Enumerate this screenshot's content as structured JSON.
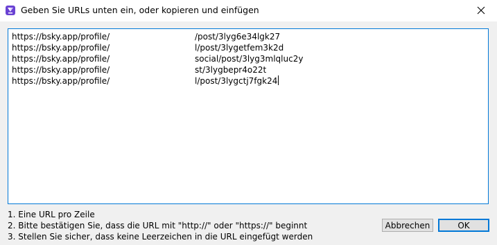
{
  "window": {
    "title": "Geben Sie URLs unten ein, oder kopieren und einfügen",
    "app_icon": "app-icon",
    "close_icon": "close-icon"
  },
  "input": {
    "lines": [
      {
        "prefix": "https://bsky.app/profile/",
        "suffix": "/post/3lyg6e34lgk27"
      },
      {
        "prefix": "https://bsky.app/profile/",
        "suffix": "l/post/3lygetfem3k2d"
      },
      {
        "prefix": "https://bsky.app/profile/",
        "suffix": "social/post/3lyg3mlqluc2y"
      },
      {
        "prefix": "https://bsky.app/profile/",
        "suffix": "st/3lygbepr4o22t"
      },
      {
        "prefix": "https://bsky.app/profile/",
        "suffix": "l/post/3lygctj7fgk24"
      }
    ]
  },
  "instructions": {
    "line1": "1. Eine URL pro Zeile",
    "line2": "2. Bitte bestätigen Sie, dass die URL mit \"http://\" oder \"https://\" beginnt",
    "line3": "3. Stellen Sie sicher, dass keine Leerzeichen in die URL eingefügt werden"
  },
  "buttons": {
    "cancel_label": "Abbrechen",
    "ok_label": "OK"
  },
  "colors": {
    "accent": "#0078d7",
    "icon": "#6a42d3",
    "background": "#f0f0f0"
  }
}
